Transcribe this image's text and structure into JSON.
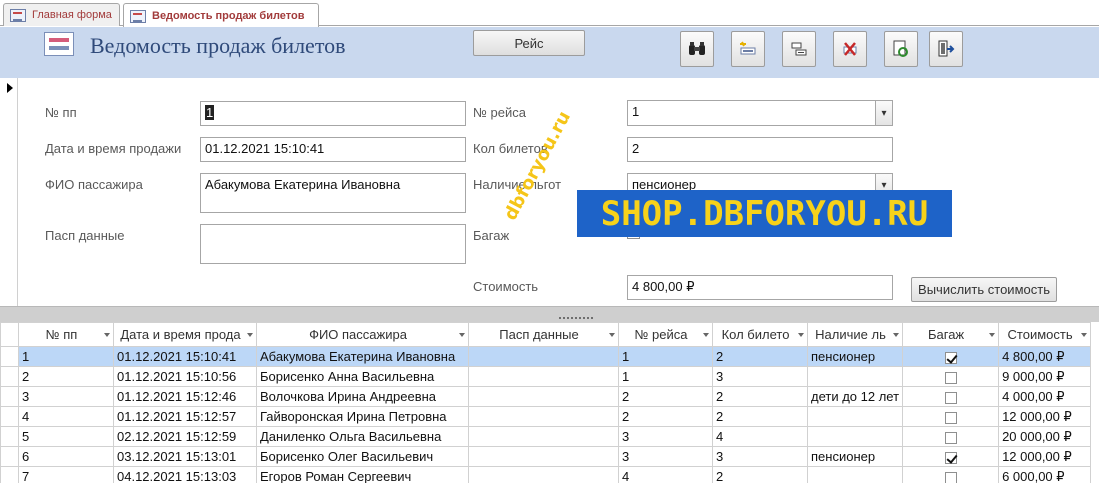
{
  "tabs": [
    {
      "label": "Главная форма",
      "active": false
    },
    {
      "label": "Ведомость продаж билетов",
      "active": true
    }
  ],
  "header": {
    "title": "Ведомость продаж билетов",
    "flight_button": "Рейс",
    "toolbar": [
      {
        "name": "binoculars-find-icon"
      },
      {
        "name": "new-record-icon"
      },
      {
        "name": "save-record-icon"
      },
      {
        "name": "delete-record-icon"
      },
      {
        "name": "refresh-icon"
      },
      {
        "name": "exit-door-icon"
      }
    ]
  },
  "form": {
    "pp": {
      "label": "№ пп",
      "value": "1"
    },
    "sale_datetime": {
      "label": "Дата и время продажи",
      "value": "01.12.2021 15:10:41"
    },
    "passenger": {
      "label": "ФИО пассажира",
      "value": "Абакумова Екатерина Ивановна"
    },
    "passport": {
      "label": "Пасп данные",
      "value": ""
    },
    "flight_no": {
      "label": "№ рейса",
      "value": "1"
    },
    "ticket_count": {
      "label": "Кол билетов",
      "value": "2"
    },
    "benefits": {
      "label": "Наличие льгот",
      "value": "пенсионер"
    },
    "baggage": {
      "label": "Багаж",
      "checked": false
    },
    "cost": {
      "label": "Стоимость",
      "value": "4 800,00 ₽"
    },
    "calc_button": "Вычислить стоимость"
  },
  "watermark": {
    "main": "SHOP.DBFORYOU.RU",
    "diagonal": "dbforyou.ru"
  },
  "table": {
    "columns": [
      "№ пп",
      "Дата и время прода",
      "ФИО пассажира",
      "Пасп данные",
      "№ рейса",
      "Кол билето",
      "Наличие ль",
      "Багаж",
      "Стоимость"
    ],
    "rows": [
      {
        "pp": "1",
        "dt": "01.12.2021 15:10:41",
        "fio": "Абакумова Екатерина Ивановна",
        "pasp": "",
        "flight": "1",
        "cnt": "2",
        "benefit": "пенсионер",
        "bag": true,
        "cost": "4 800,00 ₽"
      },
      {
        "pp": "2",
        "dt": "01.12.2021 15:10:56",
        "fio": "Борисенко Анна Васильевна",
        "pasp": "",
        "flight": "1",
        "cnt": "3",
        "benefit": "",
        "bag": false,
        "cost": "9 000,00 ₽"
      },
      {
        "pp": "3",
        "dt": "01.12.2021 15:12:46",
        "fio": "Волочкова Ирина Андреевна",
        "pasp": "",
        "flight": "2",
        "cnt": "2",
        "benefit": "дети до 12 лет",
        "bag": false,
        "cost": "4 000,00 ₽"
      },
      {
        "pp": "4",
        "dt": "01.12.2021 15:12:57",
        "fio": "Гайворонская Ирина Петровна",
        "pasp": "",
        "flight": "2",
        "cnt": "2",
        "benefit": "",
        "bag": false,
        "cost": "12 000,00 ₽"
      },
      {
        "pp": "5",
        "dt": "02.12.2021 15:12:59",
        "fio": "Даниленко Ольга Васильевна",
        "pasp": "",
        "flight": "3",
        "cnt": "4",
        "benefit": "",
        "bag": false,
        "cost": "20 000,00 ₽"
      },
      {
        "pp": "6",
        "dt": "03.12.2021 15:13:01",
        "fio": "Борисенко Олег Васильевич",
        "pasp": "",
        "flight": "3",
        "cnt": "3",
        "benefit": "пенсионер",
        "bag": true,
        "cost": "12 000,00 ₽"
      },
      {
        "pp": "7",
        "dt": "04.12.2021 15:13:03",
        "fio": "Егоров Роман Сергеевич",
        "pasp": "",
        "flight": "4",
        "cnt": "2",
        "benefit": "",
        "bag": false,
        "cost": "6 000,00 ₽"
      }
    ]
  }
}
